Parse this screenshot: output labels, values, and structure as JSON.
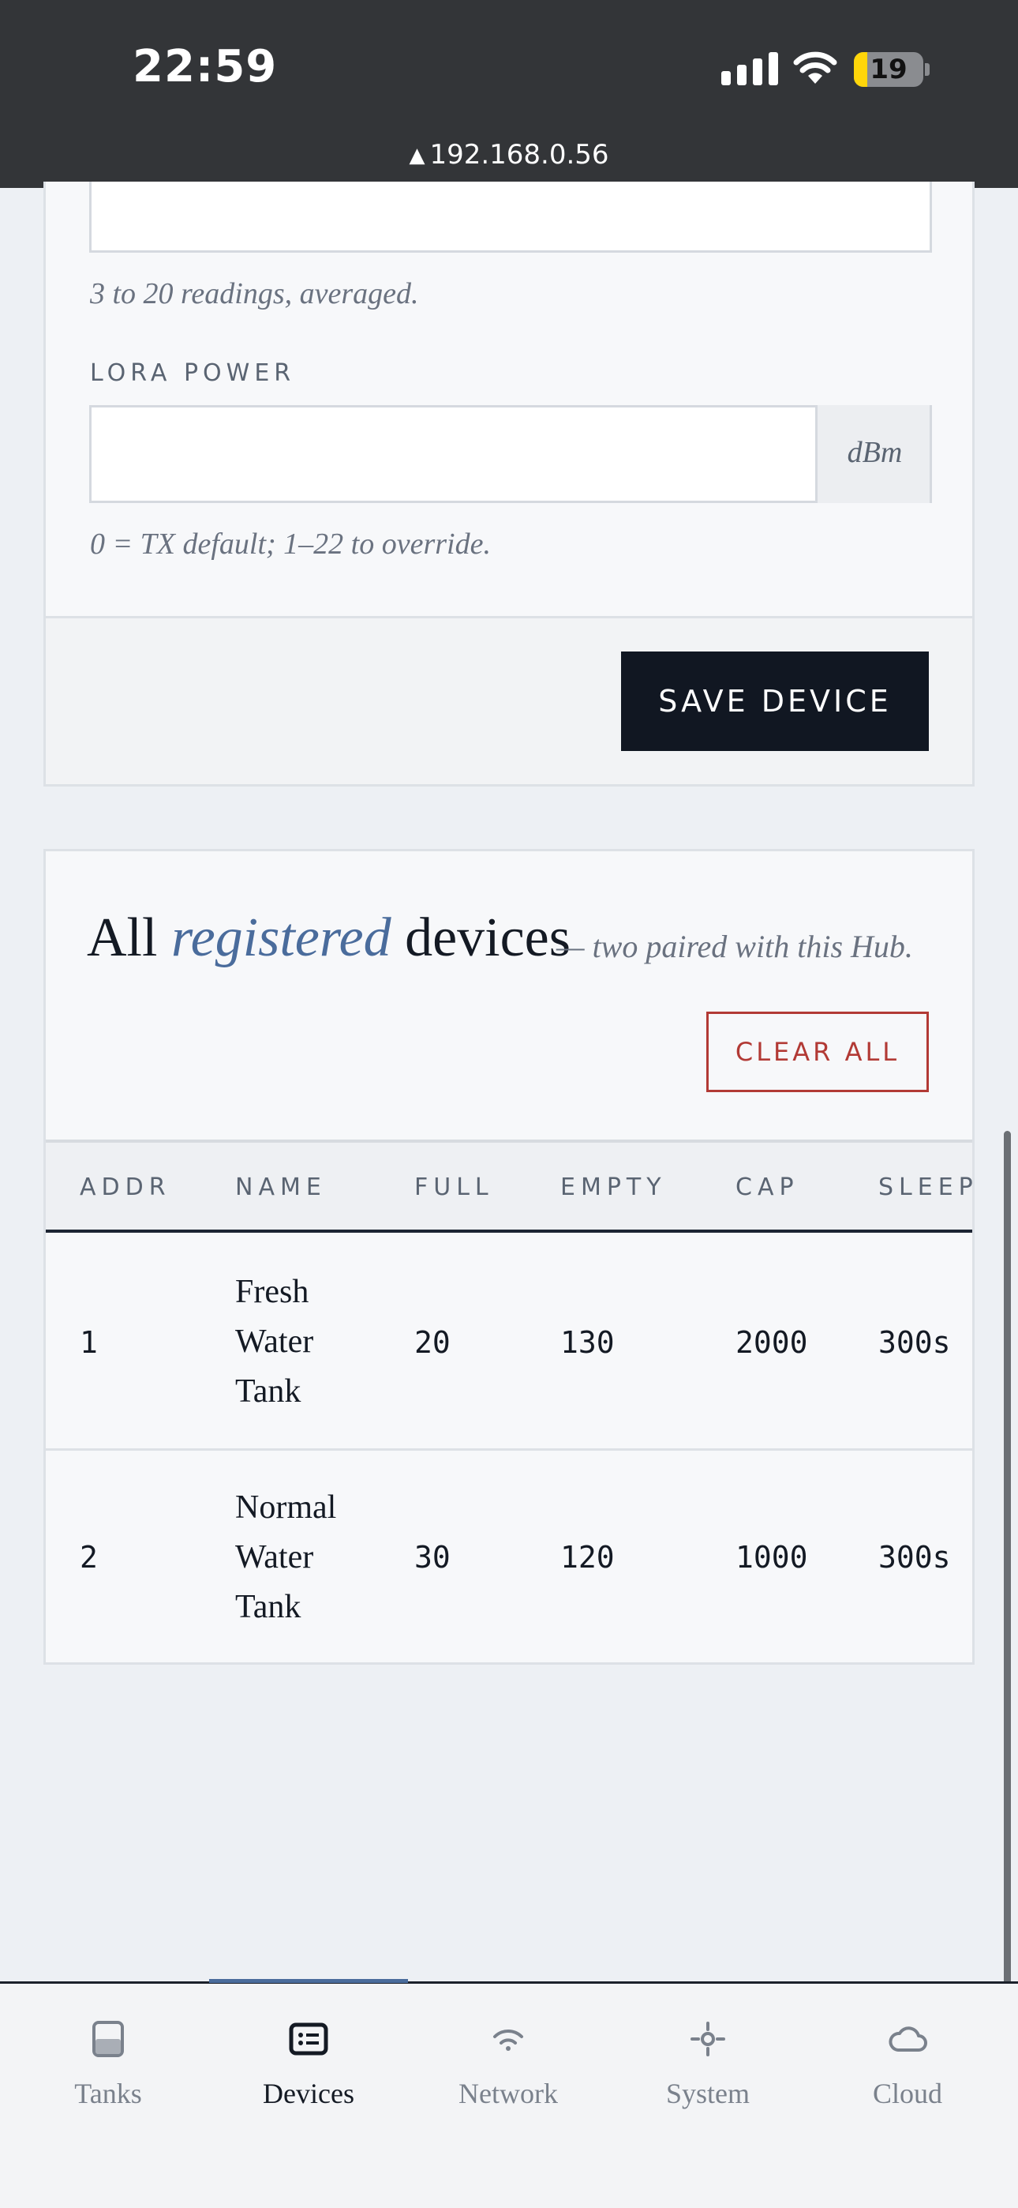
{
  "status_bar": {
    "time": "22:59",
    "battery": "19",
    "url": "192.168.0.56"
  },
  "settings_card": {
    "readings_help": "3 to 20 readings, averaged.",
    "lora_power_label": "LORA POWER",
    "lora_power_value": "",
    "lora_power_unit": "dBm",
    "lora_power_help": "0 = TX default; 1–22 to override.",
    "save_button": "SAVE DEVICE"
  },
  "devices_card": {
    "title_prefix": "All ",
    "title_highlight": "registered",
    "title_suffix": " devices",
    "subtitle": "— two paired with this Hub.",
    "clear_button": "CLEAR ALL",
    "columns": [
      "ADDR",
      "NAME",
      "FULL",
      "EMPTY",
      "CAP",
      "SLEEP"
    ],
    "rows": [
      {
        "addr": "1",
        "name": "Fresh Water Tank",
        "full": "20",
        "empty": "130",
        "cap": "2000",
        "sleep": "300s"
      },
      {
        "addr": "2",
        "name": "Normal Water Tank",
        "full": "30",
        "empty": "120",
        "cap": "1000",
        "sleep": "300s"
      }
    ]
  },
  "tabs": [
    {
      "label": "Tanks",
      "icon": "tank-icon"
    },
    {
      "label": "Devices",
      "icon": "devices-icon",
      "active": true
    },
    {
      "label": "Network",
      "icon": "wifi-icon"
    },
    {
      "label": "System",
      "icon": "system-icon"
    },
    {
      "label": "Cloud",
      "icon": "cloud-icon"
    }
  ],
  "colors": {
    "accent": "#4a6c9c",
    "primary_button": "#111722",
    "danger": "#b23a35"
  }
}
